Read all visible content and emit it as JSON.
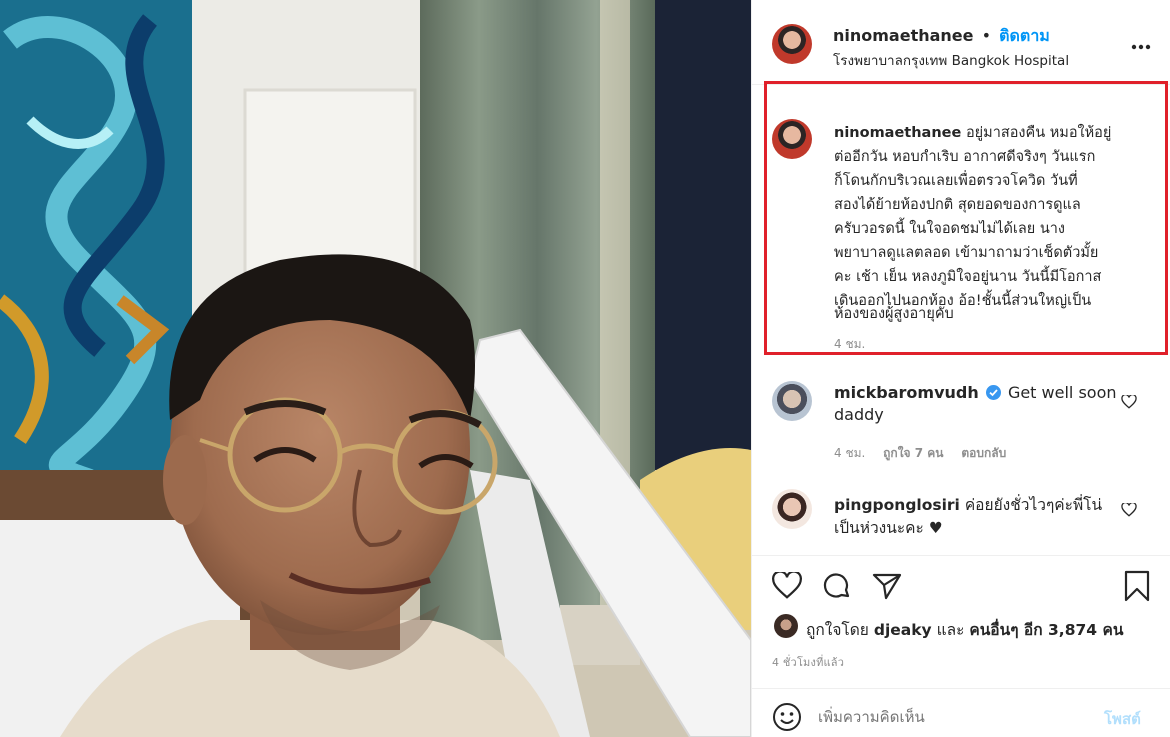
{
  "header": {
    "username": "ninomaethanee",
    "dot": "•",
    "follow_label": "ติดตาม",
    "location": "โรงพยาบาลกรุงเทพ Bangkok Hospital",
    "more_icon": "more-horizontal-icon"
  },
  "caption": {
    "username": "ninomaethanee",
    "lines": [
      "อยู่มาสองคืน หมอให้อยู่",
      "ต่ออีกวัน หอบกำเริบ อากาศดีจริงๆ วันแรก",
      "ก็โดนกักบริเวณเลยเพื่อตรวจโควิด วันที่",
      "สองได้ย้ายห้องปกติ สุดยอดของการดูแล",
      "ครับวอรดนี้ ในใจอดชมไม่ได้เลย นาง",
      "พยาบาลดูแลตลอด เข้ามาถามว่าเช็ดตัวมั้ย",
      "คะ เช้า เย็น หลงภูมิใจอยู่นาน วันนี้มีโอกาส",
      "เดินออกไปนอกห้อง อ้อ!ชั้นนี้ส่วนใหญ่เป็น",
      "ห้องของผู้สูงอายุคับ"
    ],
    "time": "4 ชม.",
    "highlight_color": "#e0202a"
  },
  "comments": [
    {
      "username": "mickbaromvudh",
      "verified": true,
      "text_line1": "Get well soon",
      "text_line2": "daddy",
      "time": "4 ชม.",
      "likes": "ถูกใจ 7 คน",
      "reply_label": "ตอบกลับ"
    },
    {
      "username": "pingponglosiri",
      "verified": false,
      "text_line1": "ค่อยยังชั่วไวๆค่ะพี่โน่",
      "text_line2": "เป็นห่วงนะคะ ♥"
    }
  ],
  "actions": {
    "like_icon": "heart-icon",
    "comment_icon": "comment-icon",
    "share_icon": "send-icon",
    "save_icon": "bookmark-icon"
  },
  "likes": {
    "prefix": "ถูกใจโดย",
    "user": "djeaky",
    "and": "และ",
    "others": "คนอื่นๆ อีก 3,874 คน"
  },
  "timestamp": "4 ชั่วโมงที่แล้ว",
  "comment_box": {
    "emoji_icon": "smiley-icon",
    "placeholder": "เพิ่มความคิดเห็น",
    "post_label": "โพสต์"
  },
  "colors": {
    "accent": "#0095f6",
    "post_disabled": "#b2dffc",
    "verified": "#3897f0"
  }
}
